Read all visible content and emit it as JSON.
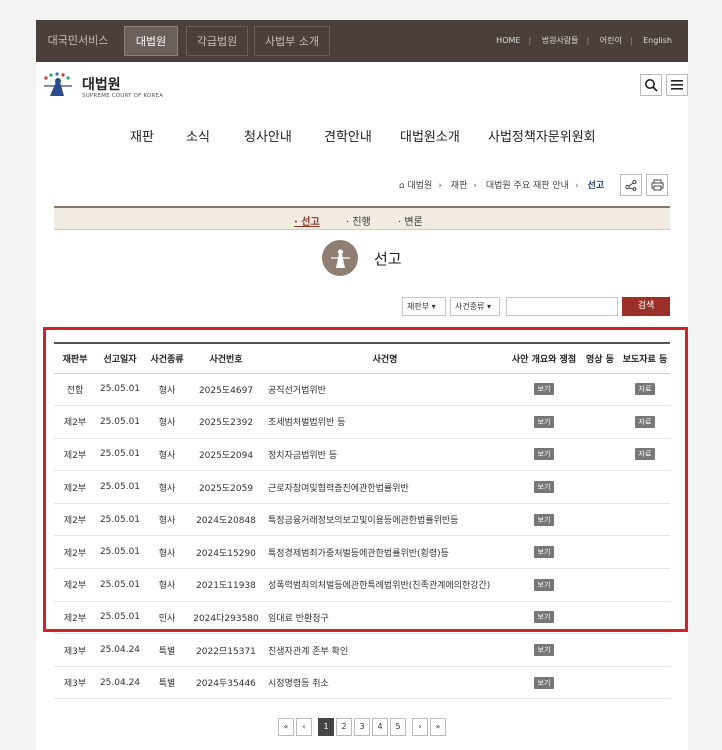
{
  "topbar": {
    "tabs": [
      "대국민서비스",
      "대법원",
      "각급법원",
      "사법부 소개"
    ],
    "links": [
      "HOME",
      "법원사람들",
      "어린이",
      "English"
    ]
  },
  "header": {
    "logo_kr": "대법원",
    "logo_en": "SUPREME COURT OF KOREA"
  },
  "mainnav": [
    "재판",
    "소식",
    "청사안내",
    "견학안내",
    "대법원소개",
    "사법정책자문위원회"
  ],
  "breadcrumb": [
    "대법원",
    "재판",
    "대법원 주요 재판 안내",
    "선고"
  ],
  "subtabs": [
    "선고",
    "진행",
    "변론"
  ],
  "page_title": "선고",
  "filters": {
    "panel": "재판부",
    "case_type": "사건종류",
    "search_label": "검색"
  },
  "table": {
    "headers": [
      "재판부",
      "선고일자",
      "사건종류",
      "사건번호",
      "사건명",
      "사안 개요와 쟁점",
      "영상 등",
      "보도자료 등"
    ],
    "rows": [
      {
        "panel": "전합",
        "date": "25.05.01",
        "type": "형사",
        "no": "2025도4697",
        "name": "공직선거법위반",
        "summary": "보기",
        "press": "자료"
      },
      {
        "panel": "제2부",
        "date": "25.05.01",
        "type": "형사",
        "no": "2025도2392",
        "name": "조세범처벌법위반 등",
        "summary": "보기",
        "press": "자료"
      },
      {
        "panel": "제2부",
        "date": "25.05.01",
        "type": "형사",
        "no": "2025도2094",
        "name": "정치자금법위반 등",
        "summary": "보기",
        "press": "자료"
      },
      {
        "panel": "제2부",
        "date": "25.05.01",
        "type": "형사",
        "no": "2025도2059",
        "name": "근로자참여및협력증진에관한법률위반",
        "summary": "보기",
        "press": ""
      },
      {
        "panel": "제2부",
        "date": "25.05.01",
        "type": "형사",
        "no": "2024도20848",
        "name": "특정금융거래정보의보고및이용등에관한법률위반등",
        "summary": "보기",
        "press": ""
      },
      {
        "panel": "제2부",
        "date": "25.05.01",
        "type": "형사",
        "no": "2024도15290",
        "name": "특정경제범죄가중처벌등에관한법률위반(횡령)등",
        "summary": "보기",
        "press": ""
      },
      {
        "panel": "제2부",
        "date": "25.05.01",
        "type": "형사",
        "no": "2021도11938",
        "name": "성폭력범죄의처벌등에관한특례법위반(친족관계에의한강간)",
        "summary": "보기",
        "press": ""
      },
      {
        "panel": "제2부",
        "date": "25.05.01",
        "type": "민사",
        "no": "2024다293580",
        "name": "임대료 반환청구",
        "summary": "보기",
        "press": ""
      },
      {
        "panel": "제3부",
        "date": "25.04.24",
        "type": "특별",
        "no": "2022므15371",
        "name": "친생자관계 존부 확인",
        "summary": "보기",
        "press": ""
      },
      {
        "panel": "제3부",
        "date": "25.04.24",
        "type": "특별",
        "no": "2024두35446",
        "name": "시정명령등 취소",
        "summary": "보기",
        "press": ""
      }
    ]
  },
  "pager": {
    "first": "«",
    "prev": "‹",
    "pages": [
      "1",
      "2",
      "3",
      "4",
      "5"
    ],
    "next": "›",
    "last": "»"
  }
}
